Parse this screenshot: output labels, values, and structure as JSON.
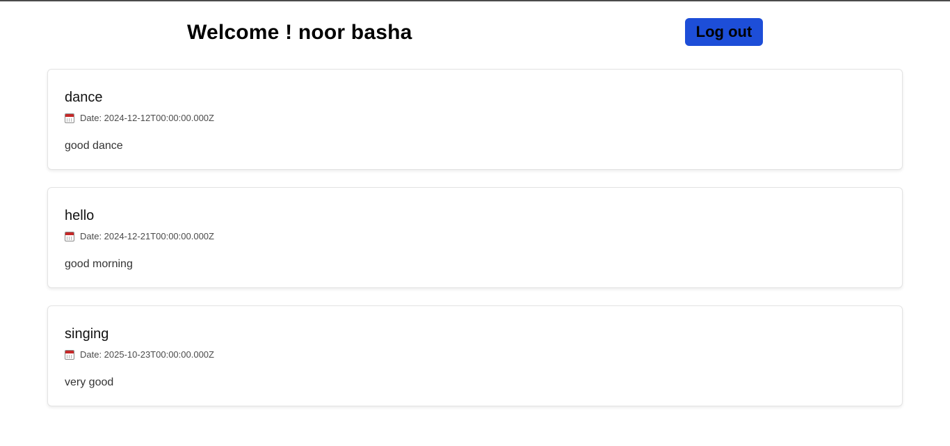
{
  "header": {
    "welcome_text": "Welcome ! noor basha",
    "logout_label": "Log out"
  },
  "colors": {
    "logout_button_bg": "#1d4ed8",
    "calendar_icon_header": "#c62828"
  },
  "events": [
    {
      "title": "dance",
      "date_label": "Date: 2024-12-12T00:00:00.000Z",
      "description": "good dance",
      "icon": "calendar-icon"
    },
    {
      "title": "hello",
      "date_label": "Date: 2024-12-21T00:00:00.000Z",
      "description": "good morning",
      "icon": "calendar-icon"
    },
    {
      "title": "singing",
      "date_label": "Date: 2025-10-23T00:00:00.000Z",
      "description": "very good",
      "icon": "calendar-icon"
    }
  ]
}
